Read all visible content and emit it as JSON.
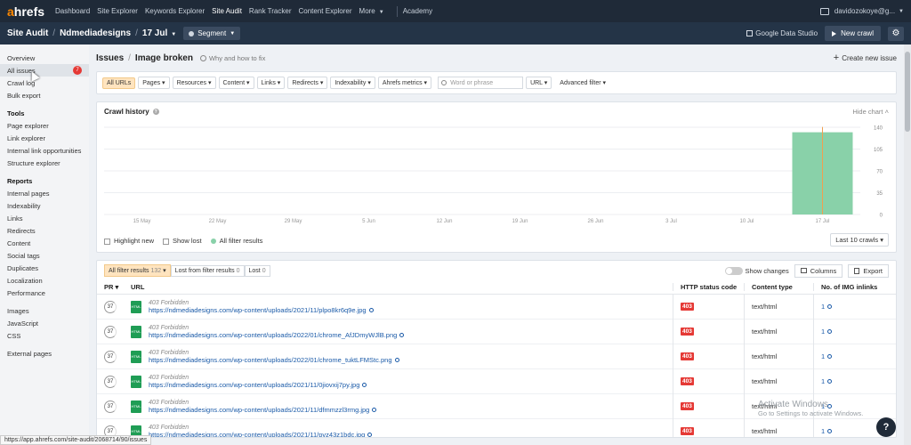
{
  "topnav": {
    "logo_a": "a",
    "logo_rest": "hrefs",
    "items": [
      "Dashboard",
      "Site Explorer",
      "Keywords Explorer",
      "Site Audit",
      "Rank Tracker",
      "Content Explorer",
      "More"
    ],
    "academy": "Academy",
    "user": "davidozokoye@g..."
  },
  "subheader": {
    "crumbs": [
      "Site Audit",
      "Ndmediadesigns",
      "17 Jul"
    ],
    "segment": "Segment",
    "google_data_studio": "Google Data Studio",
    "new_crawl": "New crawl"
  },
  "sidebar": {
    "top": [
      "Overview",
      "All issues",
      "Crawl log",
      "Bulk export"
    ],
    "issues_badge": "7",
    "tools_head": "Tools",
    "tools": [
      "Page explorer",
      "Link explorer",
      "Internal link opportunities",
      "Structure explorer"
    ],
    "reports_head": "Reports",
    "reports": [
      "Internal pages",
      "Indexability",
      "Links",
      "Redirects",
      "Content",
      "Social tags",
      "Duplicates",
      "Localization",
      "Performance"
    ],
    "resources": [
      "Images",
      "JavaScript",
      "CSS"
    ],
    "external": "External pages"
  },
  "main": {
    "title_a": "Issues",
    "title_b": "Image broken",
    "why": "Why and how to fix",
    "create_issue": "Create new issue"
  },
  "filters": {
    "all_urls": "All URLs",
    "buttons": [
      "Pages",
      "Resources",
      "Content",
      "Links",
      "Redirects",
      "Indexability",
      "Ahrefs metrics"
    ],
    "search_placeholder": "Word or phrase",
    "url_select": "URL",
    "advanced": "Advanced filter"
  },
  "chart_data": {
    "type": "bar",
    "title": "Crawl history",
    "hide_label": "Hide chart",
    "categories": [
      "15 May",
      "22 May",
      "29 May",
      "5 Jun",
      "12 Jun",
      "19 Jun",
      "26 Jun",
      "3 Jul",
      "10 Jul",
      "17 Jul"
    ],
    "values": [
      0,
      0,
      0,
      0,
      0,
      0,
      0,
      0,
      0,
      132
    ],
    "yticks": [
      140,
      105,
      70,
      35,
      0
    ],
    "ylim": [
      0,
      140
    ],
    "bar_color": "#89d1a9",
    "marker_color": "#f0a050",
    "legend": {
      "highlight_new": "Highlight new",
      "show_lost": "Show lost",
      "all_filter": "All filter results"
    },
    "last_crawls": "Last 10 crawls"
  },
  "table": {
    "tab_all": "All filter results",
    "tab_all_count": "132",
    "tab_lost_from": "Lost from filter results",
    "tab_lost_from_count": "0",
    "tab_lost": "Lost",
    "tab_lost_count": "0",
    "show_changes": "Show changes",
    "columns_btn": "Columns",
    "export_btn": "Export",
    "headers": {
      "pr": "PR",
      "url": "URL",
      "http": "HTTP status code",
      "type": "Content type",
      "img": "No. of IMG inlinks"
    },
    "rows": [
      {
        "pr": "37",
        "status": "403 Forbidden",
        "url": "https://ndmediadesigns.com/wp-content/uploads/2021/11/plpo8kr6q9e.jpg",
        "code": "403",
        "type": "text/html",
        "inlinks": "1"
      },
      {
        "pr": "37",
        "status": "403 Forbidden",
        "url": "https://ndmediadesigns.com/wp-content/uploads/2022/01/chrome_AfJDmyWJlB.png",
        "code": "403",
        "type": "text/html",
        "inlinks": "1"
      },
      {
        "pr": "37",
        "status": "403 Forbidden",
        "url": "https://ndmediadesigns.com/wp-content/uploads/2022/01/chrome_tuktLFMStc.png",
        "code": "403",
        "type": "text/html",
        "inlinks": "1"
      },
      {
        "pr": "37",
        "status": "403 Forbidden",
        "url": "https://ndmediadesigns.com/wp-content/uploads/2021/11/0jiovxij7py.jpg",
        "code": "403",
        "type": "text/html",
        "inlinks": "1"
      },
      {
        "pr": "37",
        "status": "403 Forbidden",
        "url": "https://ndmediadesigns.com/wp-content/uploads/2021/11/dfmmzzl3rmg.jpg",
        "code": "403",
        "type": "text/html",
        "inlinks": "1"
      },
      {
        "pr": "37",
        "status": "403 Forbidden",
        "url": "https://ndmediadesigns.com/wp-content/uploads/2021/11/pvz43z1bdc.jpg",
        "code": "403",
        "type": "text/html",
        "inlinks": "1"
      }
    ]
  },
  "status_bar_url": "https://app.ahrefs.com/site-audit/2068714/90/issues",
  "watermark": {
    "line1": "Activate Windows",
    "line2": "Go to Settings to activate Windows."
  },
  "help": "?"
}
